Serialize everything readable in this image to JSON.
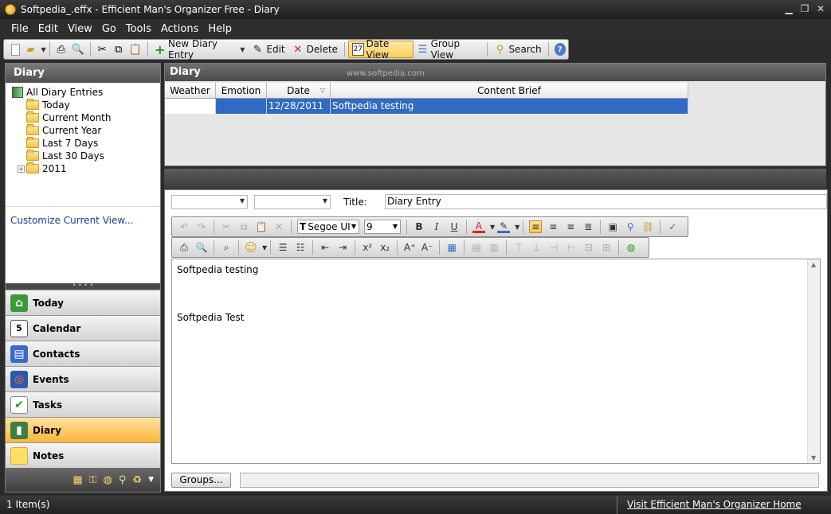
{
  "window": {
    "title": "Softpedia_.effx - Efficient Man's Organizer Free - Diary"
  },
  "menu": [
    "File",
    "Edit",
    "View",
    "Go",
    "Tools",
    "Actions",
    "Help"
  ],
  "toolbar": {
    "new_diary_entry": "New Diary Entry",
    "edit": "Edit",
    "delete": "Delete",
    "date_view": "Date View",
    "group_view": "Group View",
    "search": "Search"
  },
  "left_panel": {
    "title": "Diary",
    "tree": {
      "root": "All Diary Entries",
      "items": [
        "Today",
        "Current Month",
        "Current Year",
        "Last 7 Days",
        "Last 30 Days",
        "2011"
      ]
    },
    "customize_link": "Customize Current View...",
    "nav": [
      "Today",
      "Calendar",
      "Contacts",
      "Events",
      "Tasks",
      "Diary",
      "Notes"
    ],
    "active_nav": "Diary"
  },
  "list_panel": {
    "title": "Diary",
    "watermark": "www.softpedia.com",
    "columns": [
      "Weather",
      "Emotion",
      "Date",
      "Content Brief"
    ],
    "rows": [
      {
        "weather": "",
        "emotion": "",
        "date": "12/28/2011",
        "content": "Softpedia testing"
      }
    ]
  },
  "editor": {
    "title_label": "Title:",
    "title_value": "Diary Entry",
    "font_name": "Segoe UI",
    "font_size": "9",
    "lines": [
      "Softpedia testing",
      "",
      "",
      "",
      "Softpedia Test"
    ],
    "groups_button": "Groups..."
  },
  "status": {
    "count": "1 Item(s)",
    "link": "Visit Efficient Man's Organizer Home Page"
  },
  "colors": {
    "selection": "#316ac5",
    "active_nav": "#ffb43a",
    "chrome_dark": "#2b2b2b"
  }
}
